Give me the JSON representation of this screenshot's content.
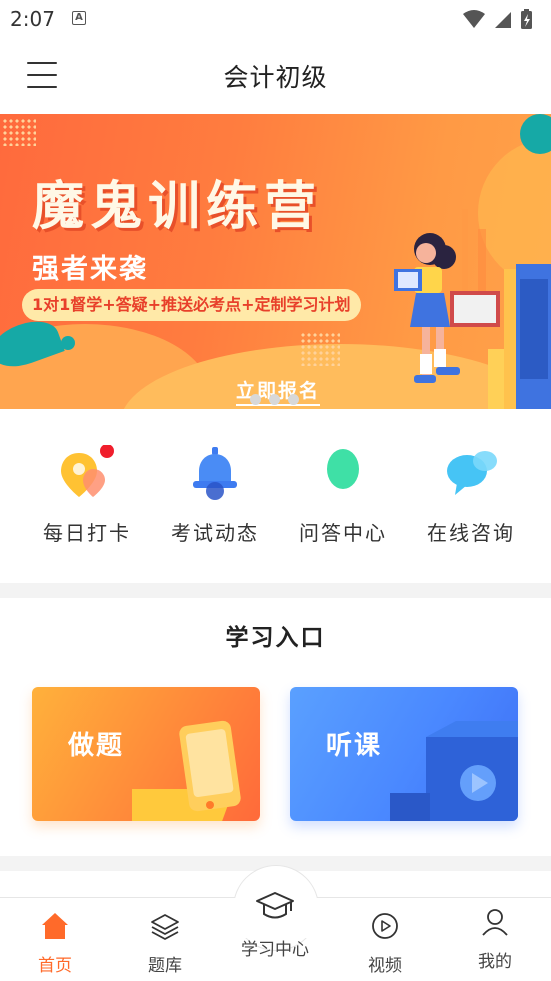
{
  "status_bar": {
    "time": "2:07",
    "notif_glyph": "A"
  },
  "header": {
    "title": "会计初级",
    "menu_icon": "hamburger-icon"
  },
  "banner": {
    "headline": "魔鬼训练营",
    "subline": "强者来袭",
    "pill": "1对1督学+答疑+推送必考点+定制学习计划",
    "cta": "立即报名",
    "dots": 3,
    "active_dot": 0,
    "accent": "#ff6a3d"
  },
  "quick_actions": [
    {
      "label": "每日打卡",
      "icon": "location-pin-icon"
    },
    {
      "label": "考试动态",
      "icon": "bell-icon"
    },
    {
      "label": "问答中心",
      "icon": "oval-icon"
    },
    {
      "label": "在线咨询",
      "icon": "chat-bubble-icon"
    }
  ],
  "study": {
    "title": "学习入口",
    "cards": [
      {
        "label": "做题",
        "icon": "phone-icon",
        "color": "#ff8a3a"
      },
      {
        "label": "听课",
        "icon": "play-icon",
        "color": "#4a88ff"
      }
    ]
  },
  "bottom_nav": {
    "active_color": "#ff6a2a",
    "items": [
      {
        "label": "首页",
        "icon": "home-icon",
        "active": true
      },
      {
        "label": "题库",
        "icon": "layers-icon",
        "active": false
      },
      {
        "label": "学习中心",
        "icon": "graduation-cap-icon",
        "active": false
      },
      {
        "label": "视频",
        "icon": "play-circle-icon",
        "active": false
      },
      {
        "label": "我的",
        "icon": "user-icon",
        "active": false
      }
    ]
  }
}
